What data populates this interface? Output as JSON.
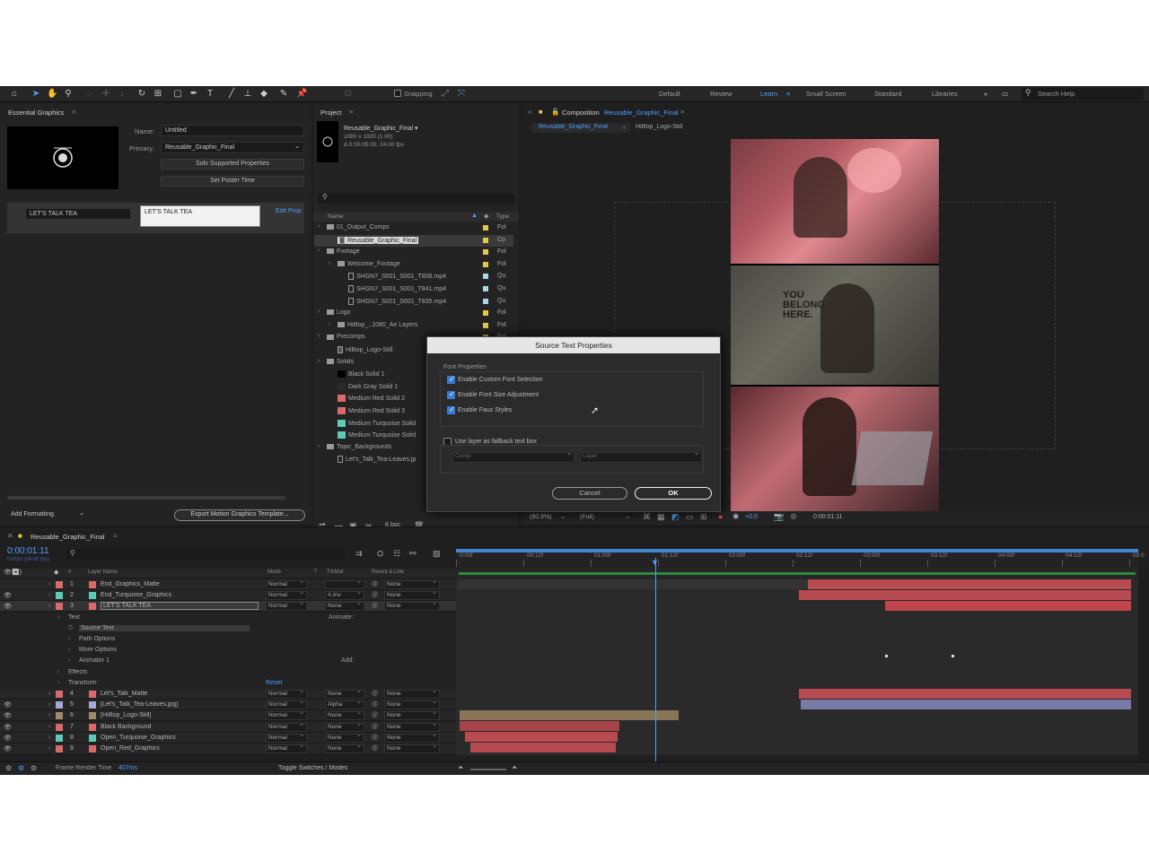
{
  "toolbar": {
    "snapping_label": "Snapping",
    "workspaces": [
      "Default",
      "Review",
      "Learn",
      "Small Screen",
      "Standard",
      "Libraries"
    ],
    "active_workspace": "Learn",
    "search_placeholder": "Search Help"
  },
  "essential_graphics": {
    "title": "Essential Graphics",
    "name_label": "Name:",
    "name_value": "Untitled",
    "primary_label": "Primary:",
    "primary_value": "Reusable_Graphic_Final",
    "solo_button": "Solo Supported Properties",
    "poster_button": "Set Poster Time",
    "text_field": "LET'S TALK TEA",
    "text_preview": "LET'S TALK TEA",
    "edit_props_link": "Edit Prop",
    "add_formatting": "Add Formatting",
    "export_button": "Export Motion Graphics Template..."
  },
  "project": {
    "title": "Project",
    "comp_name": "Reusable_Graphic_Final ▾",
    "comp_res": "1080 x 1920 (1.00)",
    "comp_dur": "Δ 0:00:05:00, 24.00 fps",
    "col_name": "Name",
    "col_type": "Type",
    "rows": [
      {
        "indent": 0,
        "kind": "folder",
        "name": "01_Output_Comps",
        "tag": "#e2c84a",
        "type": "Fol"
      },
      {
        "indent": 1,
        "kind": "comp",
        "name": "Reusable_Graphic_Final",
        "tag": "#e2c84a",
        "type": "Co",
        "selected": true
      },
      {
        "indent": 0,
        "kind": "folder",
        "name": "Footage",
        "tag": "#e2c84a",
        "type": "Fol"
      },
      {
        "indent": 1,
        "kind": "folder",
        "name": "Welcome_Footage",
        "tag": "#e2c84a",
        "type": "Fol"
      },
      {
        "indent": 2,
        "kind": "file",
        "name": "SHGN7_S001_S001_T806.mp4",
        "tag": "#a8d8e6",
        "type": "Qu"
      },
      {
        "indent": 2,
        "kind": "file",
        "name": "SHGN7_S001_S001_T841.mp4",
        "tag": "#a8d8e6",
        "type": "Qu"
      },
      {
        "indent": 2,
        "kind": "file",
        "name": "SHGN7_S001_S001_T835.mp4",
        "tag": "#a8d8e6",
        "type": "Qu"
      },
      {
        "indent": 0,
        "kind": "folder",
        "name": "Logo",
        "tag": "#e2c84a",
        "type": "Fol"
      },
      {
        "indent": 1,
        "kind": "folder",
        "name": "Hilltop_..1080_Ae Layers",
        "tag": "#e2c84a",
        "type": "Fol"
      },
      {
        "indent": 0,
        "kind": "folder",
        "name": "Precomps",
        "tag": "#e2c84a",
        "type": "Fol"
      },
      {
        "indent": 1,
        "kind": "comp",
        "name": "Hilltop_Logo-Still",
        "tag": "#e2c84a",
        "type": "Co"
      },
      {
        "indent": 0,
        "kind": "folder",
        "name": "Solids",
        "tag": "#e2c84a",
        "type": "Fol"
      },
      {
        "indent": 1,
        "kind": "solid",
        "name": "Black Solid 1",
        "swatch": "#000000",
        "tag": "#e2c84a",
        "type": ""
      },
      {
        "indent": 1,
        "kind": "solid",
        "name": "Dark Gray Solid 1",
        "swatch": "#2a2a2a",
        "tag": "#e2c84a",
        "type": ""
      },
      {
        "indent": 1,
        "kind": "solid",
        "name": "Medium Red Solid 2",
        "swatch": "#d96a6a",
        "tag": "#e2c84a",
        "type": ""
      },
      {
        "indent": 1,
        "kind": "solid",
        "name": "Medium Red Solid 3",
        "swatch": "#d96a6a",
        "tag": "#e2c84a",
        "type": ""
      },
      {
        "indent": 1,
        "kind": "solid",
        "name": "Medium Turquoise Solid",
        "swatch": "#5ec9b6",
        "tag": "#e2c84a",
        "type": ""
      },
      {
        "indent": 1,
        "kind": "solid",
        "name": "Medium Turquoise Solid",
        "swatch": "#5ec9b6",
        "tag": "#e2c84a",
        "type": ""
      },
      {
        "indent": 0,
        "kind": "folder",
        "name": "Topic_Backgrounds",
        "tag": "#e2c84a",
        "type": ""
      },
      {
        "indent": 1,
        "kind": "file",
        "name": "Let's_Talk_Tea-Leaves.jp",
        "tag": "#a8d8e6",
        "type": ""
      }
    ],
    "bpc": "8 bpc"
  },
  "composition": {
    "title": "Composition",
    "comp_link": "Reusable_Graphic_Final",
    "breadcrumb_1": "Reusable_Graphic_Final",
    "breadcrumb_2": "Hilltop_Logo-Still",
    "zoom": "(60.9%)",
    "resolution": "(Full)",
    "timecode": "0:00:01:11",
    "exposure": "+0.0",
    "overlay_text": "YOU BELONG HERE."
  },
  "dialog": {
    "title": "Source Text Properties",
    "section_label": "Font Properties",
    "opt1": "Enable Custom Font Selection",
    "opt2": "Enable Font Size Adjustment",
    "opt3": "Enable Faux Styles",
    "opt4": "Use layer as fallback text box",
    "comp_dd": "Comp",
    "layer_dd": "Layer",
    "cancel": "Cancel",
    "ok": "OK"
  },
  "timeline": {
    "tab": "Reusable_Graphic_Final",
    "timecode": "0:00:01:11",
    "timecode_sub": "00035 (24.00 fps)",
    "col_layer_name": "Layer Name",
    "col_mode": "Mode",
    "col_t": "T",
    "col_trkmat": "TrkMat",
    "col_parent": "Parent & Link",
    "ticks": [
      "0:00f",
      "00:12f",
      "01:00f",
      "01:12f",
      "02:00f",
      "02:12f",
      "03:00f",
      "03:12f",
      "04:00f",
      "04:12f",
      "05:0"
    ],
    "layers": [
      {
        "num": "1",
        "color": "#d96a6a",
        "name": "End_Graphics_Matte",
        "mode": "Normal",
        "trk": "",
        "parent": "None",
        "eye": false
      },
      {
        "num": "2",
        "color": "#5ec9b6",
        "name": "End_Turquoise_Graphics",
        "mode": "Normal",
        "trk": "A.Inv",
        "parent": "None",
        "eye": true
      },
      {
        "num": "3",
        "color": "#d96a6a",
        "name": "LET'S TALK TEA",
        "mode": "Normal",
        "trk": "None",
        "parent": "None",
        "eye": true,
        "selected": true
      }
    ],
    "sub_rows": [
      {
        "indent": 1,
        "label": "Text"
      },
      {
        "indent": 2,
        "label": "Source Text"
      },
      {
        "indent": 2,
        "label": "Path Options"
      },
      {
        "indent": 2,
        "label": "More Options"
      },
      {
        "indent": 2,
        "label": "Animator 1"
      },
      {
        "indent": 1,
        "label": "Effects"
      },
      {
        "indent": 1,
        "label": "Transform"
      }
    ],
    "animate_label": "Animate:",
    "add_label": "Add:",
    "reset_label": "Reset",
    "layers2": [
      {
        "num": "4",
        "color": "#d96a6a",
        "name": "Let's_Talk_Matte",
        "mode": "Normal",
        "trk": "None",
        "parent": "None",
        "eye": false
      },
      {
        "num": "5",
        "color": "#a8a8d8",
        "name": "[Let's_Talk_Tea-Leaves.jpg]",
        "mode": "Normal",
        "trk": "Alpha",
        "parent": "None",
        "eye": true
      },
      {
        "num": "6",
        "color": "#a08a6a",
        "name": "[Hilltop_Logo-Still]",
        "mode": "Normal",
        "trk": "None",
        "parent": "None",
        "eye": true
      },
      {
        "num": "7",
        "color": "#d96a6a",
        "name": "Black Background",
        "mode": "Normal",
        "trk": "None",
        "parent": "None",
        "eye": true
      },
      {
        "num": "8",
        "color": "#5ec9b6",
        "name": "Open_Turquoise_Graphics",
        "mode": "Normal",
        "trk": "None",
        "parent": "None",
        "eye": true
      },
      {
        "num": "9",
        "color": "#d96a6a",
        "name": "Open_Red_Graphics",
        "mode": "Normal",
        "trk": "None",
        "parent": "None",
        "eye": true
      }
    ],
    "footer_render_label": "Frame Render Time",
    "footer_render_value": "407ms",
    "toggle_label": "Toggle Switches / Modes"
  }
}
